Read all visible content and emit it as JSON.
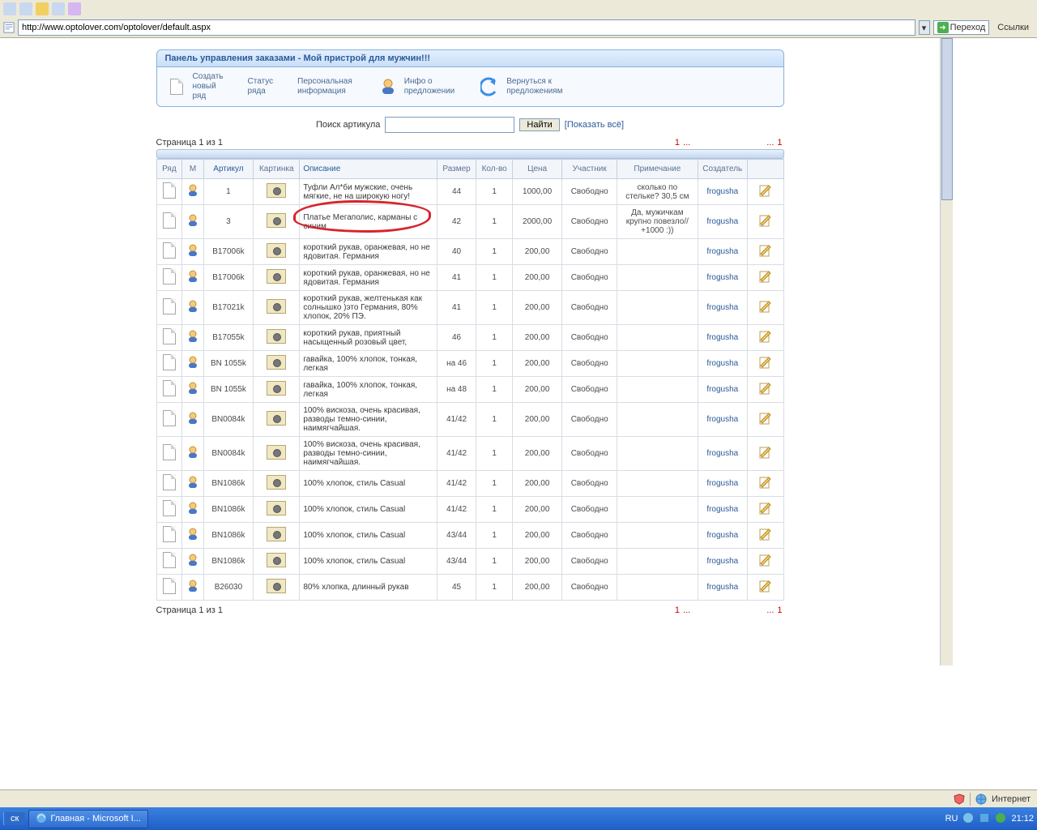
{
  "browser": {
    "url": "http://www.optolover.com/optolover/default.aspx",
    "go_label": "Переход",
    "links_label": "Ссылки"
  },
  "panel": {
    "title": "Панель управления заказами - Мой пристрой для мужчин!!!",
    "menu": [
      {
        "label": "Создать\nновый\nряд"
      },
      {
        "label": "Статус\nряда"
      },
      {
        "label": "Персональная\nинформация"
      },
      {
        "label": "Инфо о\nпредложении"
      },
      {
        "label": "Вернуться к\nпредложениям"
      }
    ]
  },
  "search": {
    "label": "Поиск артикула",
    "value": "",
    "btn": "Найти",
    "show_all": "[Показать всё]"
  },
  "pager": {
    "text": "Страница 1 из 1",
    "first": "1",
    "dots": "...",
    "last": "1"
  },
  "table": {
    "headers": {
      "ryad": "Ряд",
      "m": "М",
      "artikul": "Артикул",
      "pic": "Картинка",
      "desc": "Описание",
      "size": "Размер",
      "qty": "Кол-во",
      "price": "Цена",
      "part": "Участник",
      "note": "Примечание",
      "creator": "Создатель",
      "edit": ""
    },
    "rows": [
      {
        "art": "1",
        "desc": "Туфли Ал*би мужские, очень мягкие, не на широкую ногу!",
        "size": "44",
        "qty": "1",
        "price": "1000,00",
        "part": "Свободно",
        "note": "сколько по стельке? 30,5 см",
        "creator": "frogusha"
      },
      {
        "art": "3",
        "desc": "Платье Мегаполис, карманы с синим",
        "size": "42",
        "qty": "1",
        "price": "2000,00",
        "part": "Свободно",
        "note": "Да, мужичкам крупно повезло// +1000 :))",
        "creator": "frogusha"
      },
      {
        "art": "B17006k",
        "desc": "короткий рукав, оранжевая, но не ядовитая. Германия",
        "size": "40",
        "qty": "1",
        "price": "200,00",
        "part": "Свободно",
        "note": "",
        "creator": "frogusha"
      },
      {
        "art": "B17006k",
        "desc": "короткий рукав, оранжевая, но не ядовитая. Германия",
        "size": "41",
        "qty": "1",
        "price": "200,00",
        "part": "Свободно",
        "note": "",
        "creator": "frogusha"
      },
      {
        "art": "B17021k",
        "desc": "короткий рукав, желтенькая как солнышко )это Германия, 80% хлопок, 20% ПЭ.",
        "size": "41",
        "qty": "1",
        "price": "200,00",
        "part": "Свободно",
        "note": "",
        "creator": "frogusha"
      },
      {
        "art": "B17055k",
        "desc": "короткий рукав, приятный насыщенный розовый цвет,",
        "size": "46",
        "qty": "1",
        "price": "200,00",
        "part": "Свободно",
        "note": "",
        "creator": "frogusha"
      },
      {
        "art": "BN 1055k",
        "desc": "гавайка, 100% хлопок, тонкая, легкая",
        "size": "на 46",
        "qty": "1",
        "price": "200,00",
        "part": "Свободно",
        "note": "",
        "creator": "frogusha"
      },
      {
        "art": "BN 1055k",
        "desc": "гавайка, 100% хлопок, тонкая, легкая",
        "size": "на 48",
        "qty": "1",
        "price": "200,00",
        "part": "Свободно",
        "note": "",
        "creator": "frogusha"
      },
      {
        "art": "BN0084k",
        "desc": "100% вискоза, очень красивая, разводы темно-синии, наимягчайшая.",
        "size": "41/42",
        "qty": "1",
        "price": "200,00",
        "part": "Свободно",
        "note": "",
        "creator": "frogusha"
      },
      {
        "art": "BN0084k",
        "desc": "100% вискоза, очень красивая, разводы темно-синии, наимягчайшая.",
        "size": "41/42",
        "qty": "1",
        "price": "200,00",
        "part": "Свободно",
        "note": "",
        "creator": "frogusha"
      },
      {
        "art": "BN1086k",
        "desc": "100% хлопок, стиль Casual",
        "size": "41/42",
        "qty": "1",
        "price": "200,00",
        "part": "Свободно",
        "note": "",
        "creator": "frogusha"
      },
      {
        "art": "BN1086k",
        "desc": "100% хлопок, стиль Casual",
        "size": "41/42",
        "qty": "1",
        "price": "200,00",
        "part": "Свободно",
        "note": "",
        "creator": "frogusha"
      },
      {
        "art": "BN1086k",
        "desc": "100% хлопок, стиль Casual",
        "size": "43/44",
        "qty": "1",
        "price": "200,00",
        "part": "Свободно",
        "note": "",
        "creator": "frogusha"
      },
      {
        "art": "BN1086k",
        "desc": "100% хлопок, стиль Casual",
        "size": "43/44",
        "qty": "1",
        "price": "200,00",
        "part": "Свободно",
        "note": "",
        "creator": "frogusha"
      },
      {
        "art": "B26030",
        "desc": "80% хлопка, длинный рукав",
        "size": "45",
        "qty": "1",
        "price": "200,00",
        "part": "Свободно",
        "note": "",
        "creator": "frogusha"
      }
    ]
  },
  "statusbar": {
    "net": "Интернет"
  },
  "taskbar": {
    "start": "ск",
    "app": "Главная - Microsoft I...",
    "lang": "RU",
    "time": "21:12"
  }
}
